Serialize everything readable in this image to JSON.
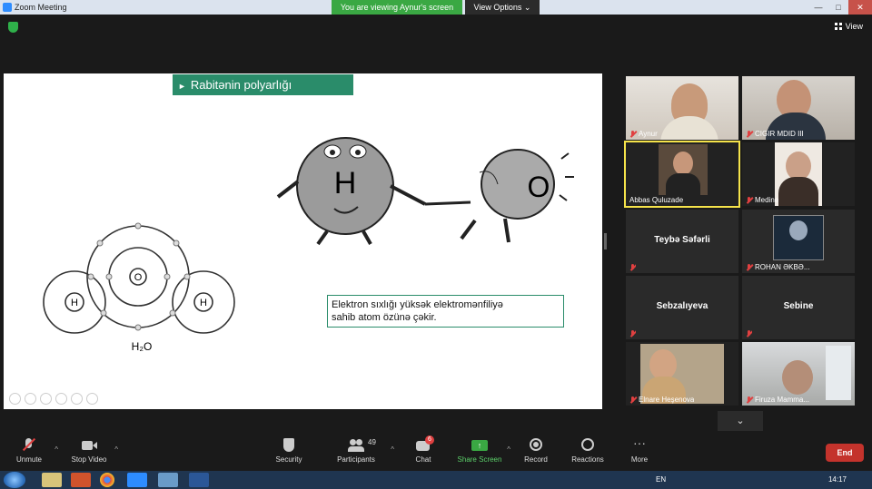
{
  "window": {
    "title": "Zoom Meeting",
    "banner": "You are viewing Aynur's screen",
    "view_options": "View Options",
    "view_label": "View"
  },
  "slide": {
    "title": "Rabitənin polyarlığı",
    "molecule_labels": {
      "h_left": "H",
      "h_right": "H",
      "o": "O",
      "formula": "H₂O"
    },
    "cartoon_labels": {
      "h": "H",
      "o": "O"
    },
    "caption_line1": "Elektron sıxlığı yüksək elektromənfiliyə",
    "caption_line2": "sahib atom özünə çəkir."
  },
  "participants": [
    {
      "name": "Aynur",
      "video": true
    },
    {
      "name": "CIGIR MDID III",
      "video": true
    },
    {
      "name": "Abbas Quluzade",
      "video": true,
      "active_speaker": true
    },
    {
      "name": "Medine",
      "video": true
    },
    {
      "name": "Teybə Səfərli",
      "video": false
    },
    {
      "name": "ROHAN ƏKBƏ...",
      "video": true
    },
    {
      "name": "Sebzalıyeva",
      "video": false
    },
    {
      "name": "Sebine",
      "video": false
    },
    {
      "name": "Elnare Heşenova",
      "video": true
    },
    {
      "name": "Firuza Mamma...",
      "video": true
    }
  ],
  "toolbar": {
    "unmute": "Unmute",
    "stop_video": "Stop Video",
    "security": "Security",
    "participants": "Participants",
    "participants_count": "49",
    "chat": "Chat",
    "chat_badge": "6",
    "share_screen": "Share Screen",
    "record": "Record",
    "reactions": "Reactions",
    "more": "More",
    "end": "End"
  },
  "taskbar": {
    "language": "EN",
    "time": "14:17"
  },
  "colors": {
    "accent_green": "#2a8c6a",
    "banner_green": "#3aa843",
    "end_red": "#c4332c",
    "active_border": "#f5e34a"
  }
}
